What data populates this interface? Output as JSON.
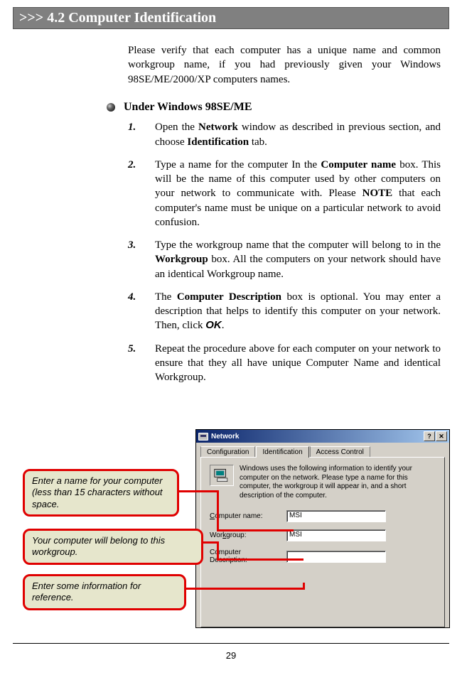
{
  "header": {
    "title": ">>> 4.2  Computer Identification"
  },
  "intro": "Please verify that each computer has a unique name and common workgroup name, if you had previously given your Windows 98SE/ME/2000/XP computers names.",
  "subsection": {
    "title": "Under Windows 98SE/ME"
  },
  "steps": [
    {
      "num": "1.",
      "pre": "Open the ",
      "b1": "Network",
      "mid1": " window as described in previous section, and choose ",
      "b2": "Identification",
      "post": " tab."
    },
    {
      "num": "2.",
      "pre": "Type a name for the computer In the ",
      "b1": "Computer name",
      "mid1": " box.  This will be the name of this computer used by other computers on your network to communicate with.  Please ",
      "b2": "NOTE",
      "post": " that each computer's name must be unique on a particular network to avoid confusion."
    },
    {
      "num": "3.",
      "pre": "Type the workgroup name that the computer will belong to in the ",
      "b1": "Workgroup",
      "mid1": " box.  All the computers on your network should have an identical Workgroup name.",
      "b2": "",
      "post": ""
    },
    {
      "num": "4.",
      "pre": "The ",
      "b1": "Computer Description",
      "mid1": " box is optional.  You may enter a description that helps to identify this computer on your network.  Then, click ",
      "ok": "OK",
      "post2": "."
    },
    {
      "num": "5.",
      "pre": "Repeat the procedure above for each computer on your network to ensure that they all have unique Computer Name and identical Workgroup.",
      "b1": "",
      "mid1": "",
      "b2": "",
      "post": ""
    }
  ],
  "dialog": {
    "title": "Network",
    "help_btn": "?",
    "close_btn": "✕",
    "tabs": {
      "config": "Configuration",
      "ident": "Identification",
      "access": "Access Control"
    },
    "info_text": "Windows uses the following information to identify your computer on the network.  Please type a name for this computer, the workgroup it will appear in, and a short description of the computer.",
    "rows": {
      "name_label_pre": "C",
      "name_label_post": "omputer name:",
      "wg_label_pre": "Wor",
      "wg_label_u": "k",
      "wg_label_post": "group:",
      "desc_label_pre": "Computer ",
      "desc_label_post": "Description:",
      "name_value": "MSI",
      "wg_value": "MSI",
      "desc_value": ""
    }
  },
  "callouts": {
    "c1": "Enter a name for your computer (less than 15 characters without space.",
    "c2": "Your computer will belong to this workgroup.",
    "c3": "Enter some information for reference."
  },
  "page_number": "29"
}
